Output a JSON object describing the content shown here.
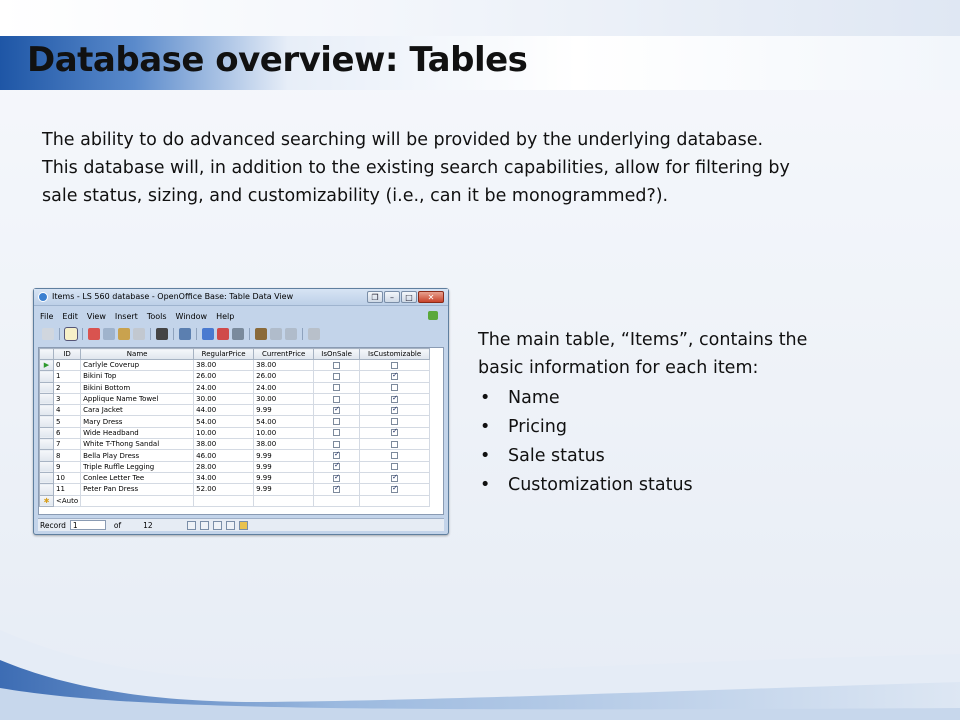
{
  "slide": {
    "title": "Database overview: Tables",
    "intro_lines": [
      "The ability to do advanced searching will be provided by the underlying database.",
      "This database will, in addition to the existing search capabilities, allow for filtering by",
      "sale status, sizing, and customizability (i.e., can it be monogrammed?)."
    ],
    "caption_lines": [
      "The main table, “Items”, contains the",
      "basic information for each item:"
    ],
    "bullets": [
      "Name",
      "Pricing",
      "Sale status",
      "Customization status"
    ],
    "bullet_glyph": "•"
  },
  "window": {
    "title": "Items - LS 560 database - OpenOffice Base: Table Data View",
    "buttons": {
      "restore": "❐",
      "minimize": "–",
      "maximize": "□",
      "close": "✕"
    },
    "menu": [
      "File",
      "Edit",
      "View",
      "Insert",
      "Tools",
      "Window",
      "Help"
    ],
    "columns": [
      "ID",
      "Name",
      "RegularPrice",
      "CurrentPrice",
      "IsOnSale",
      "IsCustomizable"
    ],
    "rows": [
      {
        "id": "0",
        "name": "Carlyle Coverup",
        "regular": "38.00",
        "current": "38.00",
        "on_sale": false,
        "customizable": false
      },
      {
        "id": "1",
        "name": "Bikini Top",
        "regular": "26.00",
        "current": "26.00",
        "on_sale": false,
        "customizable": true
      },
      {
        "id": "2",
        "name": "Bikini Bottom",
        "regular": "24.00",
        "current": "24.00",
        "on_sale": false,
        "customizable": false
      },
      {
        "id": "3",
        "name": "Applique Name Towel",
        "regular": "30.00",
        "current": "30.00",
        "on_sale": false,
        "customizable": true
      },
      {
        "id": "4",
        "name": "Cara Jacket",
        "regular": "44.00",
        "current": "9.99",
        "on_sale": true,
        "customizable": true
      },
      {
        "id": "5",
        "name": "Mary Dress",
        "regular": "54.00",
        "current": "54.00",
        "on_sale": false,
        "customizable": false
      },
      {
        "id": "6",
        "name": "Wide Headband",
        "regular": "10.00",
        "current": "10.00",
        "on_sale": false,
        "customizable": true
      },
      {
        "id": "7",
        "name": "White T-Thong Sandal",
        "regular": "38.00",
        "current": "38.00",
        "on_sale": false,
        "customizable": false
      },
      {
        "id": "8",
        "name": "Bella Play Dress",
        "regular": "46.00",
        "current": "9.99",
        "on_sale": true,
        "customizable": false
      },
      {
        "id": "9",
        "name": "Triple Ruffle Legging",
        "regular": "28.00",
        "current": "9.99",
        "on_sale": true,
        "customizable": false
      },
      {
        "id": "10",
        "name": "Conlee Letter Tee",
        "regular": "34.00",
        "current": "9.99",
        "on_sale": true,
        "customizable": true
      },
      {
        "id": "11",
        "name": "Peter Pan Dress",
        "regular": "52.00",
        "current": "9.99",
        "on_sale": true,
        "customizable": true
      }
    ],
    "new_row_text": "<Auto",
    "status": {
      "record_label": "Record",
      "record_value": "1",
      "of_label": "of",
      "total": "12"
    },
    "icons": {
      "current_row": "play-arrow-icon",
      "new_row": "asterisk-icon",
      "colors": {
        "title_band": "#1e56a6",
        "window_frame": "#c3d4ea",
        "close_button": "#c8432b"
      }
    }
  }
}
